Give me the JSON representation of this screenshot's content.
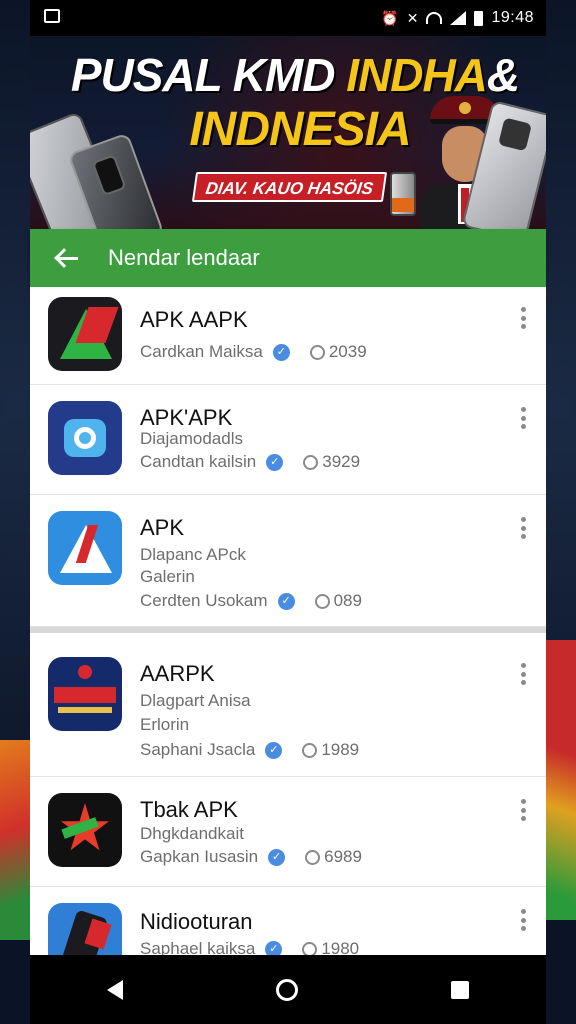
{
  "status_bar": {
    "time": "19:48",
    "icons": [
      "notification-icon",
      "alarm-icon",
      "mute-icon",
      "wifi-icon",
      "signal-icon",
      "battery-icon"
    ]
  },
  "banner": {
    "title_line1_white": "PUSAL KMD ",
    "title_line1_yellow": "INDHA",
    "title_line1_tail": "&",
    "title_line2": "INDNESIA",
    "tag": "DIAV. KAUO HASÖIS"
  },
  "app_bar": {
    "title": "Nendar lendaar",
    "color": "#3c9e3f"
  },
  "apps": [
    {
      "name": "APK AAPK",
      "lines": [],
      "meta": "Cardkan Maiksa",
      "date": "2039"
    },
    {
      "name": "APK'APK",
      "lines": [
        "Diajamodadls"
      ],
      "meta": "Candtan kailsin",
      "date": "3929"
    },
    {
      "name": "APK",
      "lines": [
        "Dlapanc APck",
        "Galerin"
      ],
      "meta": "Cerdten Usokam",
      "date": "089"
    },
    {
      "name": "AARPK",
      "lines": [
        "Dlagpart Anisa",
        "Erlorin"
      ],
      "meta": "Saphani Jsacla",
      "date": "1989"
    },
    {
      "name": "Tbak APK",
      "lines": [
        "Dhgkdandkait"
      ],
      "meta": "Gapkan Iusasin",
      "date": "6989"
    },
    {
      "name": "Nidiooturan",
      "lines": [],
      "meta": "Saphael kaiksa",
      "date": "1980"
    }
  ],
  "colors": {
    "accent_green": "#3c9e3f",
    "verified_blue": "#4a8de0",
    "banner_yellow": "#f5c518",
    "banner_red": "#c61f25"
  }
}
